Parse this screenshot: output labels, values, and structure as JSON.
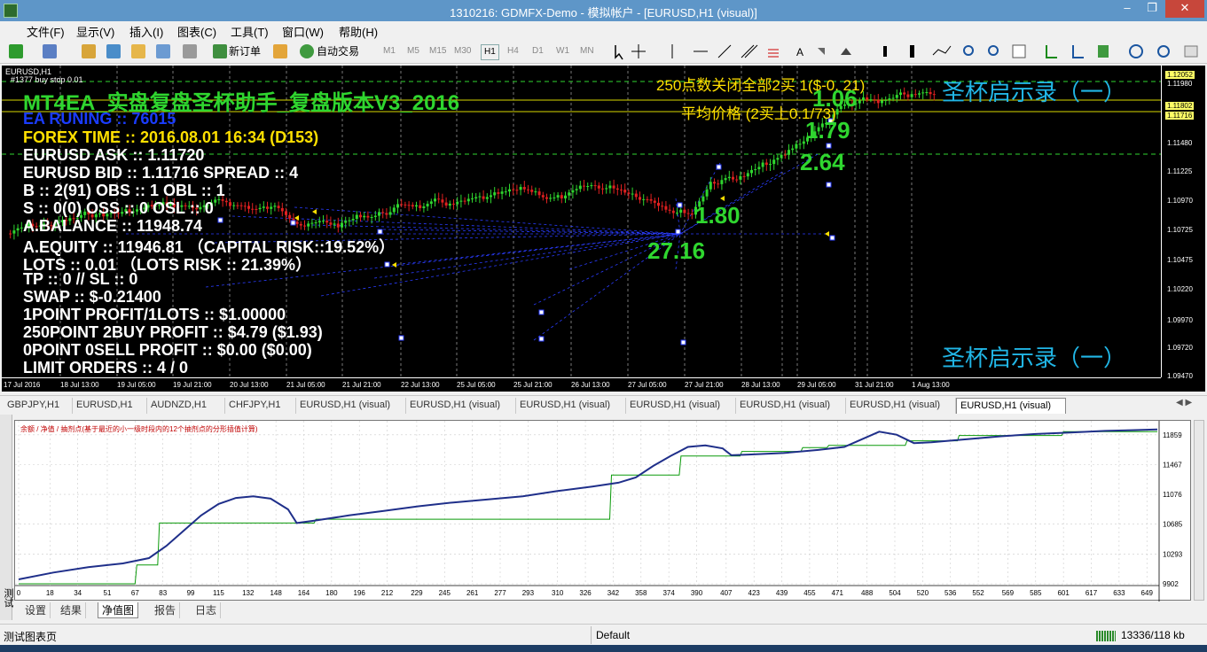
{
  "window": {
    "title": "1310216: GDMFX-Demo - 模拟帐户 - [EURUSD,H1 (visual)]",
    "min": "–",
    "restore": "❐",
    "close": "✕"
  },
  "menu": [
    "文件(F)",
    "显示(V)",
    "插入(I)",
    "图表(C)",
    "工具(T)",
    "窗口(W)",
    "帮助(H)"
  ],
  "toolbar": {
    "new_order": "新订单",
    "auto_trade": "自动交易",
    "timeframes": [
      "M1",
      "M5",
      "M15",
      "M30",
      "H1",
      "H4",
      "D1",
      "W1",
      "MN"
    ],
    "active_timeframe": "H1"
  },
  "chart": {
    "symbol_label": "EURUSD,H1",
    "order_line_label": "#1377 buy stop 0.01",
    "header": "MT4EA_实盘复盘圣杯助手_复盘版本V3_2016",
    "ea_status": "EA  RUNING :: 76015",
    "forex_time": "FOREX TIME :: 2016.08.01 16:34 (D153)",
    "info_lines": [
      "EURUSD ASK :: 1.11720",
      "EURUSD BID :: 1.11716   SPREAD :: 4",
      "B :: 2(91)  OBS :: 1  OBL :: 1",
      "S :: 0(0)  OSS :: 0  OSL :: 0",
      "A.BALANCE :: 11948.74",
      "A.EQUITY :: 11946.81 （CAPITAL RISK::19.52%）",
      "LOTS :: 0.01 （LOTS RISK :: 21.39%）",
      "TP :: 0 // SL :: 0",
      "SWAP :: $-0.21400",
      "1POINT PROFIT/1LOTS :: $1.00000",
      "250POINT 2BUY PROFIT :: $4.79 ($1.93)",
      "0POINT 0SELL PROFIT :: $0.00 ($0.00)",
      "LIMIT  ORDERS :: 4 / 0"
    ],
    "close_info": "250点数关闭全部2买 1($-0. 21)",
    "avg_price": "平均价格 (2买上0.1/73)",
    "brand_top": "圣杯启示录（一）",
    "brand_bottom": "圣杯启示录（一）",
    "big_numbers": [
      "1.06",
      "1.79",
      "2.64",
      "1.80",
      "27.16"
    ],
    "price_labels": [
      "1.12052",
      "1.11980",
      "1.11802",
      "1.11716",
      "1.11480",
      "1.11225",
      "1.10970",
      "1.10725",
      "1.10475",
      "1.10220",
      "1.09970",
      "1.09720",
      "1.09470"
    ],
    "time_labels": [
      "17 Jul 2016",
      "18 Jul 13:00",
      "19 Jul 05:00",
      "19 Jul 21:00",
      "20 Jul 13:00",
      "21 Jul 05:00",
      "21 Jul 21:00",
      "22 Jul 13:00",
      "25 Jul 05:00",
      "25 Jul 21:00",
      "26 Jul 13:00",
      "27 Jul 05:00",
      "27 Jul 21:00",
      "28 Jul 13:00",
      "29 Jul 05:00",
      "31 Jul 21:00",
      "1 Aug 13:00"
    ]
  },
  "chart_tabs": [
    "GBPJPY,H1",
    "EURUSD,H1",
    "AUDNZD,H1",
    "CHFJPY,H1",
    "EURUSD,H1 (visual)",
    "EURUSD,H1 (visual)",
    "EURUSD,H1 (visual)",
    "EURUSD,H1 (visual)",
    "EURUSD,H1 (visual)",
    "EURUSD,H1 (visual)",
    "EURUSD,H1 (visual)"
  ],
  "active_chart_tab": 10,
  "tester": {
    "side_label": "测试",
    "legend": "余额 / 净值 / 抽剂点(基于最近的小一级时段内的12个抽剂点的分形插值计算)",
    "tabs": [
      "设置",
      "结果",
      "净值图",
      "报告",
      "日志"
    ],
    "active_tab": 2
  },
  "chart_data": {
    "type": "line",
    "x_ticks": [
      0,
      18,
      34,
      51,
      67,
      83,
      99,
      115,
      132,
      148,
      164,
      180,
      196,
      212,
      229,
      245,
      261,
      277,
      293,
      310,
      326,
      342,
      358,
      374,
      390,
      407,
      423,
      439,
      455,
      471,
      488,
      504,
      520,
      536,
      552,
      569,
      585,
      601,
      617,
      633,
      649
    ],
    "y_ticks": [
      9902,
      10293,
      10685,
      11076,
      11467,
      11859
    ],
    "ylim": [
      9902,
      11950
    ],
    "xlim": [
      0,
      655
    ],
    "series": [
      {
        "name": "余额",
        "color": "#0a9a0a",
        "x": [
          0,
          67,
          68,
          80,
          81,
          145,
          146,
          170,
          171,
          340,
          341,
          380,
          381,
          415,
          416,
          450,
          451,
          465,
          466,
          510,
          511,
          540,
          541,
          600,
          601,
          655
        ],
        "y": [
          9902,
          9902,
          10150,
          10150,
          10700,
          10700,
          10700,
          10700,
          10750,
          10750,
          11330,
          11330,
          11580,
          11580,
          11640,
          11640,
          11690,
          11690,
          11720,
          11720,
          11780,
          11780,
          11850,
          11850,
          11900,
          11900
        ]
      },
      {
        "name": "净值",
        "color": "#1f2f8a",
        "x": [
          0,
          20,
          40,
          60,
          75,
          85,
          95,
          105,
          115,
          125,
          135,
          145,
          155,
          160,
          170,
          190,
          210,
          230,
          250,
          270,
          290,
          310,
          330,
          345,
          355,
          365,
          375,
          385,
          395,
          405,
          410,
          420,
          440,
          460,
          475,
          485,
          495,
          505,
          515,
          525,
          545,
          565,
          585,
          605,
          625,
          640,
          655
        ],
        "y": [
          9960,
          10050,
          10120,
          10170,
          10240,
          10400,
          10600,
          10800,
          10950,
          11030,
          11050,
          11020,
          10880,
          10700,
          10730,
          10800,
          10860,
          10920,
          10970,
          11010,
          11050,
          11120,
          11180,
          11230,
          11300,
          11450,
          11580,
          11700,
          11720,
          11680,
          11590,
          11600,
          11620,
          11660,
          11700,
          11800,
          11900,
          11860,
          11750,
          11760,
          11800,
          11840,
          11870,
          11890,
          11910,
          11920,
          11930
        ]
      }
    ]
  },
  "statusbar": {
    "left": "测试图表页",
    "middle": "Default",
    "right": "13336/118 kb"
  }
}
